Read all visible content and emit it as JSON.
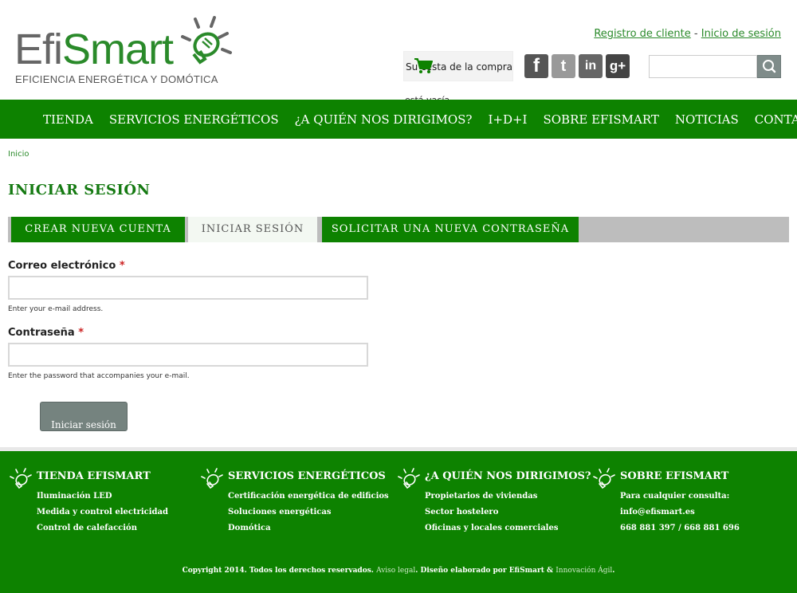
{
  "logo": {
    "word_efi": "Efi",
    "word_smart": "Smart",
    "tagline": "EFICIENCIA ENERGÉTICA Y DOMÓTICA"
  },
  "user_links": {
    "register": "Registro de cliente",
    "separator": "-",
    "login": "Inicio de sesión"
  },
  "cart": {
    "text": "Su cesta de la compra",
    "empty_text": "está vacía"
  },
  "social": {
    "facebook": "f",
    "twitter": "t",
    "linkedin": "in",
    "googleplus": "g+"
  },
  "search": {
    "placeholder": "",
    "icon": "search-icon"
  },
  "nav": {
    "items": [
      "TIENDA",
      "SERVICIOS ENERGÉTICOS",
      "¿A QUIÉN NOS DIRIGIMOS?",
      "I+D+I",
      "SOBRE EFISMART",
      "NOTICIAS",
      "CONTACTO"
    ]
  },
  "breadcrumb": "Inicio",
  "page_title": "INICIAR SESIÓN",
  "tabs": [
    {
      "label": "CREAR NUEVA CUENTA",
      "active": false
    },
    {
      "label": "INICIAR SESIÓN",
      "active": true
    },
    {
      "label": "SOLICITAR UNA NUEVA CONTRASEÑA",
      "active": false
    }
  ],
  "form": {
    "email_label": "Correo electrónico",
    "email_required": "*",
    "email_value": "",
    "email_desc": "Enter your e-mail address.",
    "password_label": "Contraseña",
    "password_required": "*",
    "password_value": "",
    "password_desc": "Enter the password that accompanies your e-mail.",
    "submit_label": "Iniciar sesión"
  },
  "footer": {
    "columns": [
      {
        "title": "TIENDA EFISMART",
        "items": [
          "Iluminación LED",
          "Medida y control electricidad",
          "Control de calefacción"
        ]
      },
      {
        "title": "SERVICIOS ENERGÉTICOS",
        "items": [
          "Certificación energética de edificios",
          "Soluciones energéticas",
          "Domótica"
        ]
      },
      {
        "title": "¿A QUIÉN NOS DIRIGIMOS?",
        "items": [
          "Propietarios de viviendas",
          "Sector hostelero",
          "Oficinas y locales comerciales"
        ]
      },
      {
        "title": "SOBRE EFISMART",
        "items": [
          "Para cualquier consulta:",
          "info@efismart.es",
          "668 881 397 / 668 881 696"
        ]
      }
    ],
    "copyright_pre": "Copyright 2014. Todos los derechos reservados. ",
    "legal_link": "Aviso legal",
    "copyright_mid": ". Diseño elaborado por EfiSmart & ",
    "agency_link": "Innovación Ágil",
    "copyright_post": "."
  },
  "colors": {
    "brand_green": "#0d8200",
    "link_green": "#2a8a2a",
    "tab_bar_gray": "#bdbdbd",
    "button_gray": "#75837f"
  }
}
